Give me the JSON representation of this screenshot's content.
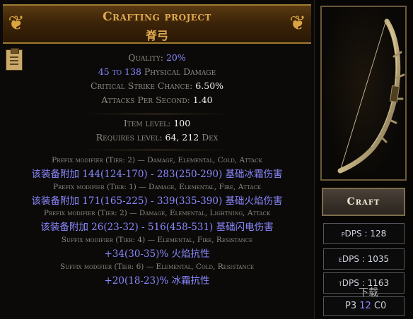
{
  "header": {
    "title": "Crafting project",
    "item_name": "脊弓"
  },
  "item": {
    "quality_label": "Quality: ",
    "quality_value": "20%",
    "damage_range": "45 to 138",
    "damage_type": " Physical Damage",
    "crit_label": "Critical Strike Chance: ",
    "crit_value": "6.50%",
    "aps_label": "Attacks Per Second: ",
    "aps_value": "1.40",
    "item_level_label": "Item level: ",
    "item_level_value": "100",
    "requires_label": "Requires level: ",
    "requires_value": "64, 212",
    "requires_stat": " Dex"
  },
  "modifiers": [
    {
      "header": "Prefix modifier (Tier: 2) — Damage, Elemental, Cold, Attack",
      "text": "该装备附加 144(124-170) - 283(250-290) 基础冰霜伤害"
    },
    {
      "header": "Prefix modifier (Tier: 1) — Damage, Elemental, Fire, Attack",
      "text": "该装备附加 171(165-225) - 339(335-390) 基础火焰伤害"
    },
    {
      "header": "Prefix modifier (Tier: 2) — Damage, Elemental, Lightning, Attack",
      "text": "该装备附加 26(23-32) - 516(458-531) 基础闪电伤害"
    },
    {
      "header": "Suffix modifier (Tier: 4) — Elemental, Fire, Resistance",
      "text": "+34(30-35)% 火焰抗性"
    },
    {
      "header": "Suffix modifier (Tier: 6) — Elemental, Cold, Resistance",
      "text": "+20(18-23)% 冰霜抗性"
    }
  ],
  "actions": {
    "craft_label": "Craft"
  },
  "stats": {
    "pdps_label": "pDPS :",
    "pdps_value": "128",
    "edps_label": "eDPS :",
    "edps_value": "1035",
    "tdps_label": "tDPS :",
    "tdps_value": "1163"
  },
  "sockets": {
    "red": "P3",
    "green": "12",
    "blue": "C0"
  },
  "watermark": "下载",
  "colors": {
    "header_gold": "#e0a951",
    "magic_blue": "#8a88ff",
    "muted_gray": "#8d8b83",
    "socket_red": "#b0a0ff",
    "socket_green": "#8a88ff"
  }
}
